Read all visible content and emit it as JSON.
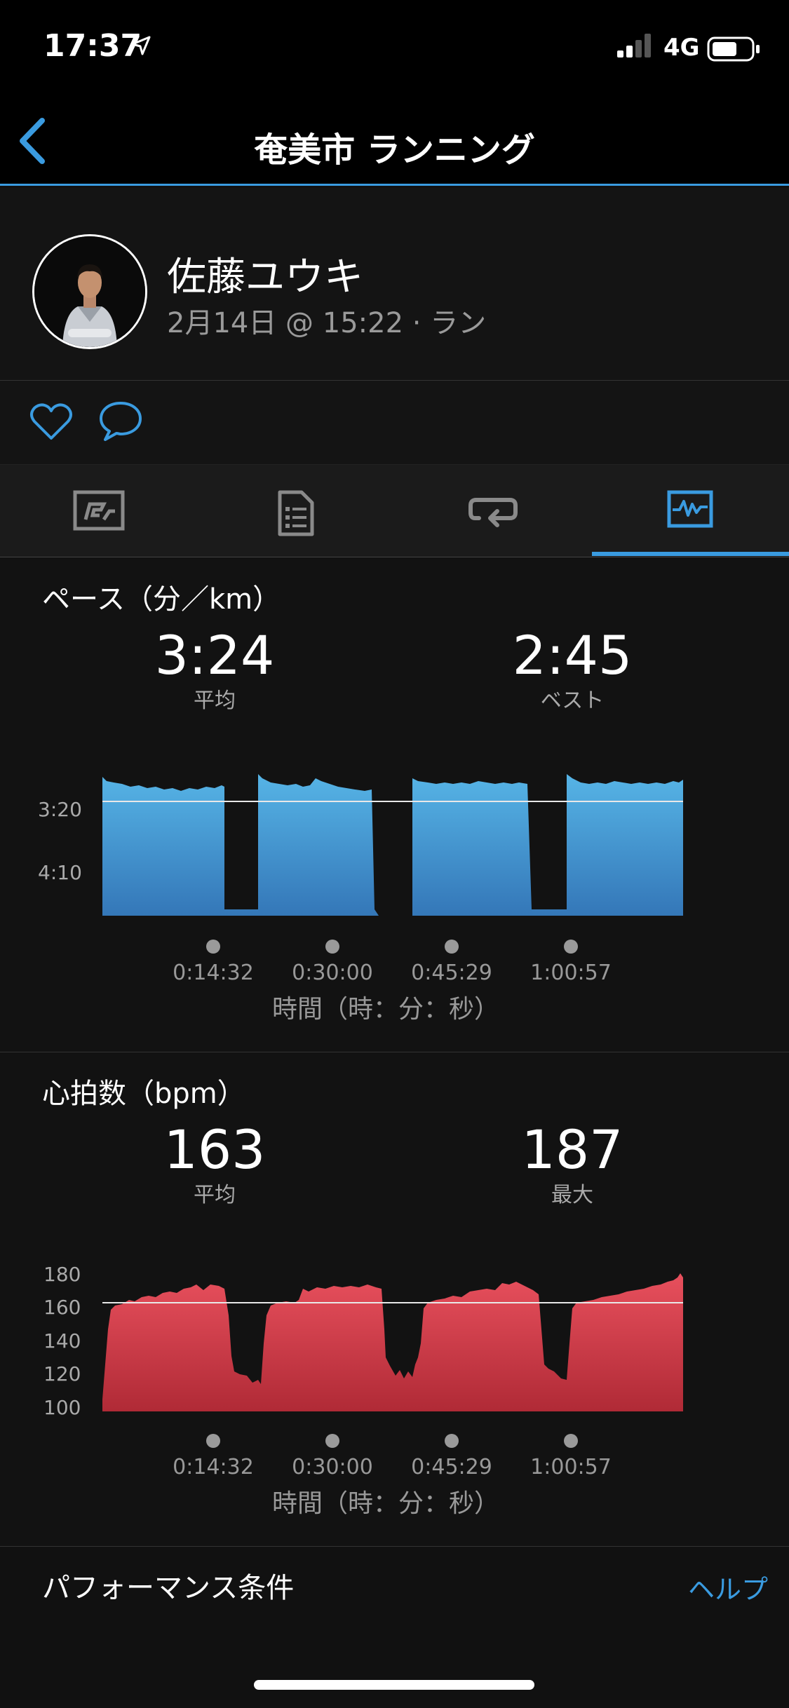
{
  "status": {
    "time": "17:37",
    "network": "4G"
  },
  "nav": {
    "title": "奄美市 ランニング"
  },
  "profile": {
    "name": "佐藤ユウキ",
    "meta": "2月14日 @ 15:22 · ラン"
  },
  "tabs": [
    "overview-icon",
    "details-icon",
    "laps-icon",
    "charts-icon"
  ],
  "pace": {
    "title": "ペース（分／km）",
    "avg_value": "3:24",
    "avg_label": "平均",
    "best_value": "2:45",
    "best_label": "ベスト",
    "y_ticks": [
      "3:20",
      "4:10"
    ],
    "x_ticks": [
      "0:14:32",
      "0:30:00",
      "0:45:29",
      "1:00:57"
    ],
    "x_axis_title": "時間（時：分：秒）",
    "color": "#4aa3db"
  },
  "hr": {
    "title": "心拍数（bpm）",
    "avg_value": "163",
    "avg_label": "平均",
    "max_value": "187",
    "max_label": "最大",
    "y_ticks": [
      "180",
      "160",
      "140",
      "120",
      "100"
    ],
    "x_ticks": [
      "0:14:32",
      "0:30:00",
      "0:45:29",
      "1:00:57"
    ],
    "x_axis_title": "時間（時：分：秒）",
    "color": "#d94452"
  },
  "performance": {
    "title": "パフォーマンス条件",
    "help": "ヘルプ"
  }
}
